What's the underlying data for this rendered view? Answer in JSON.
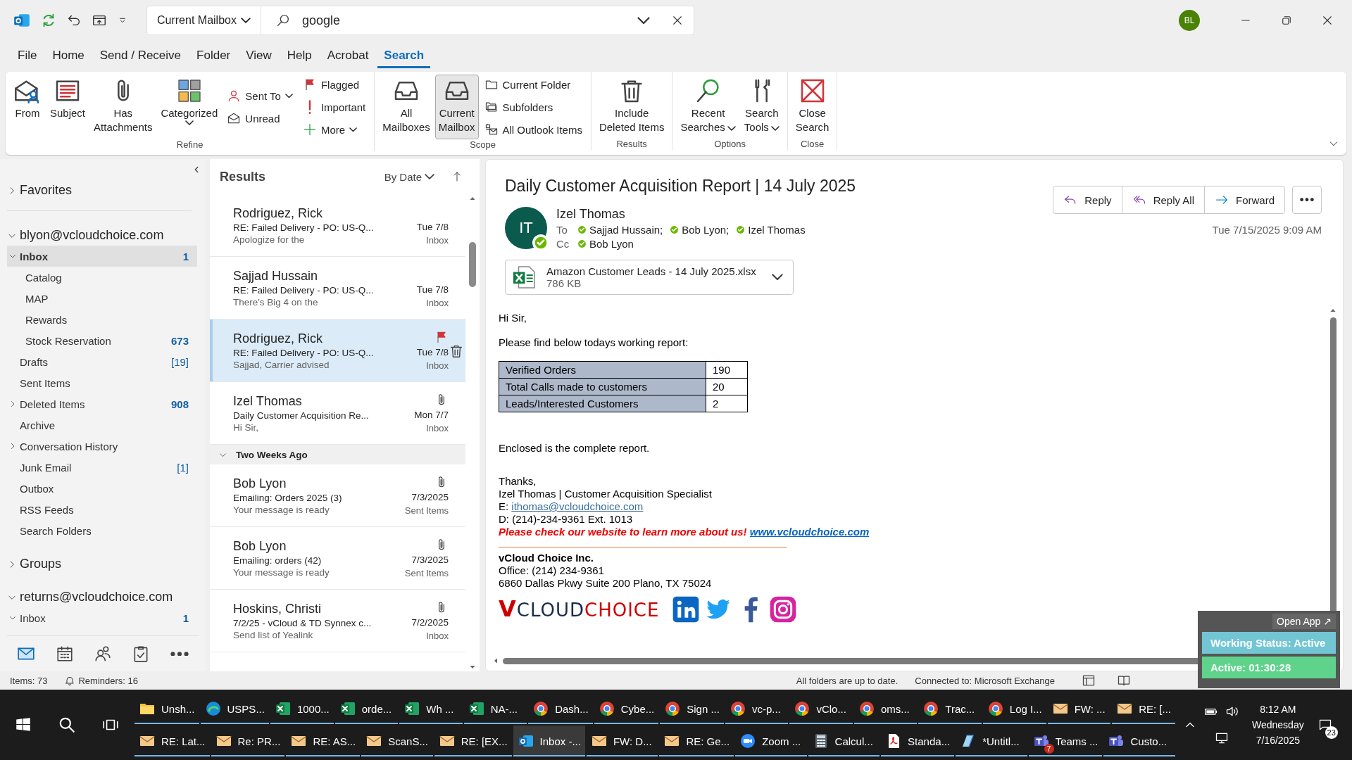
{
  "titlebar": {
    "scope": "Current Mailbox",
    "search_value": "google",
    "avatar": "BL"
  },
  "menu_tabs": [
    {
      "label": "File",
      "selected": false
    },
    {
      "label": "Home",
      "selected": false
    },
    {
      "label": "Send / Receive",
      "selected": false
    },
    {
      "label": "Folder",
      "selected": false
    },
    {
      "label": "View",
      "selected": false
    },
    {
      "label": "Help",
      "selected": false
    },
    {
      "label": "Acrobat",
      "selected": false
    },
    {
      "label": "Search",
      "selected": true
    }
  ],
  "ribbon": {
    "groups": [
      {
        "label": "Refine",
        "large": [
          {
            "lines": [
              "From"
            ],
            "selected": false
          },
          {
            "lines": [
              "Subject"
            ],
            "selected": false
          },
          {
            "lines": [
              "Has",
              "Attachments"
            ],
            "selected": false
          },
          {
            "lines": [
              "Categorized"
            ],
            "dropdown": true,
            "selected": false
          }
        ],
        "small_columns": [
          [
            {
              "label": "Sent To",
              "dropdown": true
            },
            {
              "label": "Unread"
            }
          ],
          [
            {
              "label": "Flagged"
            },
            {
              "label": "Important"
            },
            {
              "label": "More",
              "dropdown": true
            }
          ]
        ]
      },
      {
        "label": "Scope",
        "large": [
          {
            "lines": [
              "All",
              "Mailboxes"
            ],
            "selected": false
          },
          {
            "lines": [
              "Current",
              "Mailbox"
            ],
            "selected": true
          }
        ],
        "small_columns": [
          [
            {
              "label": "Current Folder"
            },
            {
              "label": "Subfolders"
            },
            {
              "label": "All Outlook Items"
            }
          ]
        ]
      },
      {
        "label": "Results",
        "large": [
          {
            "lines": [
              "Include",
              "Deleted Items"
            ],
            "selected": false
          }
        ]
      },
      {
        "label": "Options",
        "large": [
          {
            "lines": [
              "Recent",
              "Searches"
            ],
            "dropdown": true,
            "selected": false
          },
          {
            "lines": [
              "Search",
              "Tools"
            ],
            "dropdown": true,
            "selected": false
          }
        ]
      },
      {
        "label": "Close",
        "large": [
          {
            "lines": [
              "Close",
              "Search"
            ],
            "selected": false
          }
        ]
      }
    ]
  },
  "folders": {
    "favorites": {
      "label": "Favorites",
      "expanded": false
    },
    "accounts": [
      {
        "label": "blyon@vcloudchoice.com",
        "expanded": true,
        "folders": [
          {
            "label": "Inbox",
            "count": "1",
            "count_unread": true,
            "expanded": true,
            "selected": true,
            "children": [
              {
                "label": "Catalog",
                "selected": false
              },
              {
                "label": "MAP",
                "selected": false
              },
              {
                "label": "Rewards",
                "selected": false
              },
              {
                "label": "Stock Reservation",
                "count": "673",
                "count_unread": true,
                "selected": false
              }
            ]
          },
          {
            "label": "Drafts",
            "count": "[19]",
            "count_unread": false,
            "selected": false
          },
          {
            "label": "Sent Items",
            "selected": false
          },
          {
            "label": "Deleted Items",
            "count": "908",
            "count_unread": true,
            "expanded": false,
            "selected": false
          },
          {
            "label": "Archive",
            "selected": false
          },
          {
            "label": "Conversation History",
            "expanded": false,
            "selected": false
          },
          {
            "label": "Junk Email",
            "count": "[1]",
            "count_unread": false,
            "selected": false
          },
          {
            "label": "Outbox",
            "selected": false
          },
          {
            "label": "RSS Feeds",
            "selected": false
          },
          {
            "label": "Search Folders",
            "selected": false
          }
        ]
      },
      {
        "label": "Groups",
        "expanded": false
      },
      {
        "label": "returns@vcloudchoice.com",
        "expanded": true,
        "folders": [
          {
            "label": "Inbox",
            "count": "1",
            "count_unread": true,
            "expanded": true,
            "selected": false
          }
        ]
      }
    ]
  },
  "message_list": {
    "title": "Results",
    "sort": "By Date",
    "items": [
      {
        "kind": "message",
        "sender": "Rodriguez, Rick",
        "subject": "RE: Failed Delivery - PO: US-Q...",
        "preview": "Apologize for the",
        "date": "Tue 7/8",
        "folder": "Inbox",
        "attachment": false,
        "selected": false
      },
      {
        "kind": "message",
        "sender": "Sajjad Hussain",
        "subject": "RE: Failed Delivery - PO: US-Q...",
        "preview": "There's Big 4 on the",
        "date": "Tue 7/8",
        "folder": "Inbox",
        "attachment": false,
        "selected": false
      },
      {
        "kind": "message",
        "sender": "Rodriguez, Rick",
        "subject": "RE: Failed Delivery - PO: US-Q...",
        "preview": "Sajjad,  Carrier advised",
        "date": "Tue 7/8",
        "folder": "Inbox",
        "attachment": false,
        "selected": true
      },
      {
        "kind": "message",
        "sender": "Izel Thomas",
        "subject": "Daily Customer Acquisition Re...",
        "preview": "Hi Sir,",
        "date": "Mon 7/7",
        "folder": "Inbox",
        "attachment": true,
        "selected": false
      },
      {
        "kind": "group",
        "label": "Two Weeks Ago",
        "expanded": true
      },
      {
        "kind": "message",
        "sender": "Bob Lyon",
        "subject": "Emailing: Orders 2025 (3)",
        "preview": "Your message is ready",
        "date": "7/3/2025",
        "folder": "Sent Items",
        "attachment": true,
        "selected": false
      },
      {
        "kind": "message",
        "sender": "Bob Lyon",
        "subject": "Emailing: orders (42)",
        "preview": "Your message is ready",
        "date": "7/3/2025",
        "folder": "Sent Items",
        "attachment": true,
        "selected": false
      },
      {
        "kind": "message",
        "sender": "Hoskins, Christi",
        "subject": "7/2/25 - vCloud & TD Synnex c...",
        "preview": "Send list of Yealink",
        "date": "7/2/2025",
        "folder": "Inbox",
        "attachment": true,
        "selected": false
      }
    ]
  },
  "message": {
    "subject": "Daily Customer Acquisition Report | 14 July 2025",
    "sender_initials": "IT",
    "sender": "Izel Thomas",
    "to_label": "To",
    "to": [
      "Sajjad Hussain;",
      "Bob Lyon;",
      "Izel Thomas"
    ],
    "cc_label": "Cc",
    "cc": [
      "Bob Lyon"
    ],
    "date": "Tue 7/15/2025 9:09 AM",
    "actions": [
      "Reply",
      "Reply All",
      "Forward"
    ],
    "attachment": {
      "name": "Amazon Customer Leads - 14 July 2025.xlsx",
      "size": "786 KB"
    },
    "body": {
      "greeting": "Hi Sir,",
      "intro": "Please find below todays working report:",
      "table": [
        [
          "Verified Orders",
          "190"
        ],
        [
          "Total Calls made to customers",
          "20"
        ],
        [
          "Leads/Interested Customers",
          "2"
        ]
      ],
      "closing": "Enclosed is the complete report.",
      "signature": {
        "thanks": "Thanks,",
        "name_title": "Izel Thomas | Customer Acquisition Specialist",
        "email_label": "E: ",
        "email": "ithomas@vcloudchoice.com",
        "phone": "D: (214)-234-9361 Ext. 1013",
        "promo": "Please check our website to learn more about us!",
        "website": "www.vcloudchoice.com",
        "company": "vCloud Choice Inc.",
        "office": "Office: (214) 234-9361",
        "address": "6860 Dallas Pkwy Suite 200 Plano, TX 75024",
        "logo_first": "V",
        "logo_mid": "CLOUD",
        "logo_last": "CHOICE"
      }
    }
  },
  "status_bar": {
    "items": "Items: 73",
    "reminders": "Reminders: 16",
    "sync": "All folders are up to date.",
    "connection": "Connected to: Microsoft Exchange"
  },
  "widget": {
    "open_app": "Open App ↗",
    "status": "Working Status: Active",
    "timer": "Active: 01:30:28"
  },
  "taskbar": {
    "row1": [
      {
        "label": "Unsh...",
        "kind": "folder",
        "selected": false
      },
      {
        "label": "USPS...",
        "kind": "edge",
        "selected": false
      },
      {
        "label": "1000...",
        "kind": "excel",
        "selected": false
      },
      {
        "label": "orde...",
        "kind": "excel",
        "selected": false
      },
      {
        "label": "Wh ...",
        "kind": "excel",
        "selected": false
      },
      {
        "label": "NA-...",
        "kind": "excel",
        "selected": false
      },
      {
        "label": "Dash...",
        "kind": "chrome",
        "selected": false
      },
      {
        "label": "Cybe...",
        "kind": "chrome",
        "selected": false
      },
      {
        "label": "Sign ...",
        "kind": "chrome",
        "selected": false
      },
      {
        "label": "vc-p...",
        "kind": "chrome",
        "selected": false
      },
      {
        "label": "vClo...",
        "kind": "chrome",
        "selected": false
      },
      {
        "label": "oms...",
        "kind": "chrome",
        "selected": false
      },
      {
        "label": "Trac...",
        "kind": "chrome",
        "selected": false
      },
      {
        "label": "Log I...",
        "kind": "chrome",
        "selected": false
      },
      {
        "label": "FW: ...",
        "kind": "mail",
        "selected": false
      },
      {
        "label": "RE: [...",
        "kind": "mail",
        "selected": false
      }
    ],
    "row2": [
      {
        "label": "RE: Lat...",
        "kind": "mail",
        "selected": false
      },
      {
        "label": "Re: PR...",
        "kind": "mail",
        "selected": false
      },
      {
        "label": "RE: AS...",
        "kind": "mail",
        "selected": false
      },
      {
        "label": "ScanS...",
        "kind": "mail",
        "selected": false
      },
      {
        "label": "RE: [EX...",
        "kind": "mail",
        "selected": false
      },
      {
        "label": "Inbox -...",
        "kind": "outlook",
        "selected": true
      },
      {
        "label": "FW: D...",
        "kind": "mail",
        "selected": false
      },
      {
        "label": "RE: Ge...",
        "kind": "mail",
        "selected": false
      },
      {
        "label": "Zoom ...",
        "kind": "zoom",
        "selected": false
      },
      {
        "label": "Calcul...",
        "kind": "calculator",
        "selected": false
      },
      {
        "label": "Standa...",
        "kind": "pdf",
        "selected": false
      },
      {
        "label": "*Untitl...",
        "kind": "paint",
        "selected": false
      },
      {
        "label": "Teams ...",
        "kind": "teams",
        "badge": "7",
        "selected": false
      },
      {
        "label": "Custo...",
        "kind": "teams",
        "selected": false
      }
    ],
    "clock": {
      "time": "8:12 AM",
      "day": "Wednesday",
      "date": "7/16/2025"
    },
    "notifications": "23"
  }
}
